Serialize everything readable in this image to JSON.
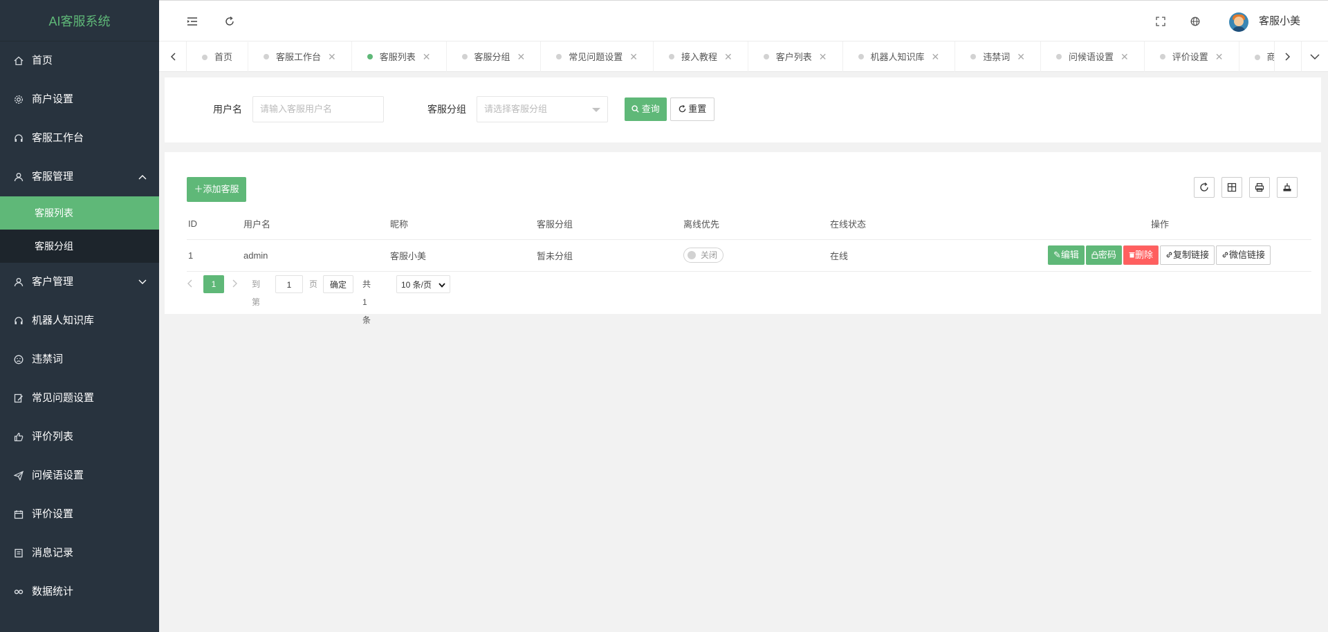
{
  "app": {
    "title": "AI客服系统"
  },
  "sidebar": {
    "items": [
      {
        "label": "首页",
        "icon": "home-icon"
      },
      {
        "label": "商户设置",
        "icon": "gear-icon"
      },
      {
        "label": "客服工作台",
        "icon": "headset-icon"
      },
      {
        "label": "客服管理",
        "icon": "user-icon",
        "expanded": true
      },
      {
        "label": "客户管理",
        "icon": "user-icon",
        "expanded": false
      },
      {
        "label": "机器人知识库",
        "icon": "headset-icon"
      },
      {
        "label": "违禁词",
        "icon": "face-icon"
      },
      {
        "label": "常见问题设置",
        "icon": "edit-icon"
      },
      {
        "label": "评价列表",
        "icon": "thumb-up-icon"
      },
      {
        "label": "问候语设置",
        "icon": "send-icon"
      },
      {
        "label": "评价设置",
        "icon": "calendar-icon"
      },
      {
        "label": "消息记录",
        "icon": "note-icon"
      },
      {
        "label": "数据统计",
        "icon": "link-icon"
      }
    ],
    "sub_items": [
      {
        "label": "客服列表",
        "active": true
      },
      {
        "label": "客服分组",
        "active": false
      }
    ]
  },
  "header": {
    "username": "客服小美"
  },
  "tabs": [
    {
      "label": "首页",
      "closable": false,
      "active": false
    },
    {
      "label": "客服工作台",
      "closable": true,
      "active": false
    },
    {
      "label": "客服列表",
      "closable": true,
      "active": true
    },
    {
      "label": "客服分组",
      "closable": true,
      "active": false
    },
    {
      "label": "常见问题设置",
      "closable": true,
      "active": false
    },
    {
      "label": "接入教程",
      "closable": true,
      "active": false
    },
    {
      "label": "客户列表",
      "closable": true,
      "active": false
    },
    {
      "label": "机器人知识库",
      "closable": true,
      "active": false
    },
    {
      "label": "违禁词",
      "closable": true,
      "active": false
    },
    {
      "label": "问候语设置",
      "closable": true,
      "active": false
    },
    {
      "label": "评价设置",
      "closable": true,
      "active": false
    },
    {
      "label": "商户设置",
      "closable": false,
      "active": false
    }
  ],
  "search": {
    "username_label": "用户名",
    "username_placeholder": "请输入客服用户名",
    "group_label": "客服分组",
    "group_placeholder": "请选择客服分组",
    "query_label": "查询",
    "reset_label": "重置"
  },
  "toolbar": {
    "add_label": "添加客服"
  },
  "table": {
    "headers": [
      "ID",
      "用户名",
      "昵称",
      "客服分组",
      "离线优先",
      "在线状态",
      "操作"
    ],
    "rows": [
      {
        "id": "1",
        "username": "admin",
        "nickname": "客服小美",
        "group": "暂未分组",
        "offline_first": "关闭",
        "status": "在线"
      }
    ],
    "actions": {
      "edit": "编辑",
      "password": "密码",
      "delete": "删除",
      "copy_link": "复制链接",
      "wechat_link": "微信链接"
    }
  },
  "pagination": {
    "current": "1",
    "goto_label": "到第",
    "page_input": "1",
    "page_unit": "页",
    "confirm": "确定",
    "total": "共 1 条",
    "page_size": "10 条/页"
  },
  "colors": {
    "accent": "#5fb878",
    "sidebar": "#28333e",
    "danger": "#ff5f5f"
  }
}
